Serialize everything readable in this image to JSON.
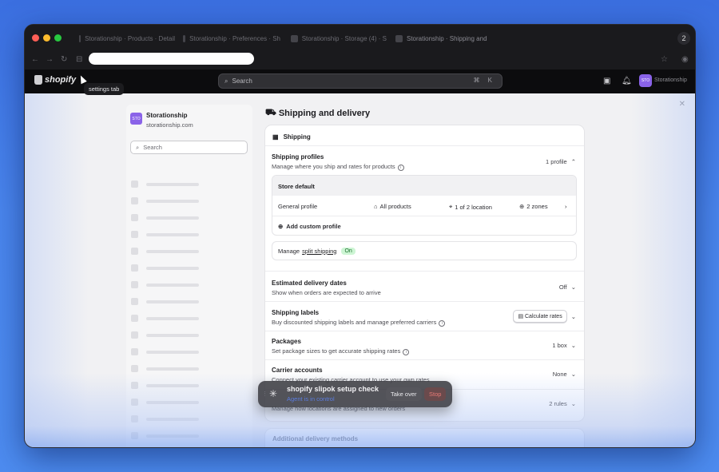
{
  "browser": {
    "tabs": [
      {
        "label": "Storationship · Products · Detail"
      },
      {
        "label": "Storationship · Preferences · Sh"
      },
      {
        "label": "Storationship · Storage (4) · S"
      },
      {
        "label": "Storationship · Shipping and"
      }
    ],
    "tab_count": "2",
    "url": ""
  },
  "topbar": {
    "logo_text": "shopify",
    "search_placeholder": "Search",
    "shortcut": "⌘ K",
    "avatar_initials": "STO",
    "store_name": "Storationship",
    "tooltip": "settings tab"
  },
  "sidebar": {
    "avatar_initials": "STO",
    "store_name": "Storationship",
    "store_domain": "storationship.com",
    "search_placeholder": "Search"
  },
  "page": {
    "title": "Shipping and delivery"
  },
  "shipping": {
    "header": "Shipping",
    "profiles_title": "Shipping profiles",
    "profiles_sub": "Manage where you ship and rates for products",
    "profiles_count": "1 profile",
    "store_default": "Store default",
    "general_profile": "General profile",
    "all_products": "All products",
    "location": "1 of 2 location",
    "zones": "2 zones",
    "add_custom_profile": "Add custom profile",
    "manage_label": "Manage",
    "split_shipping": "split shipping",
    "split_status": "On",
    "delivery_dates_title": "Estimated delivery dates",
    "delivery_dates_sub": "Show when orders are expected to arrive",
    "delivery_dates_value": "Off",
    "labels_title": "Shipping labels",
    "labels_sub": "Buy discounted shipping labels and manage preferred carriers",
    "calculate_rates": "Calculate rates",
    "packages_title": "Packages",
    "packages_sub": "Set package sizes to get accurate shipping rates",
    "packages_value": "1 box",
    "carrier_title": "Carrier accounts",
    "carrier_sub": "Connect your existing carrier account to use your own rates",
    "carrier_value": "None",
    "rules_sub": "Manage how locations are assigned to new orders",
    "rules_value": "2 rules",
    "additional_methods": "Additional delivery methods"
  },
  "agent": {
    "title": "shopify slipok setup check",
    "status": "Agent is in control",
    "take_over": "Take over",
    "stop": "Stop"
  }
}
